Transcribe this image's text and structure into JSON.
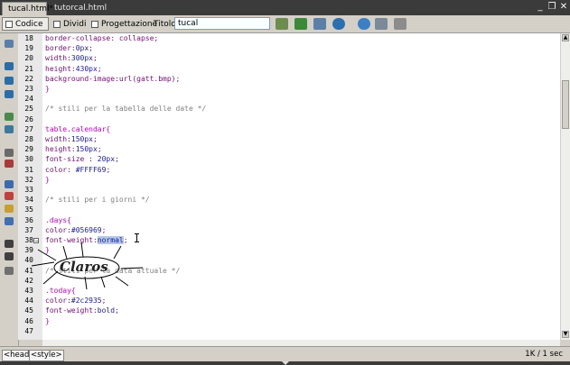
{
  "tabs": [
    {
      "label": "tucal.html*",
      "active": true
    },
    {
      "label": "tutorcal.html",
      "active": false
    }
  ],
  "window_controls": {
    "minimize": "_",
    "restore": "❐",
    "close": "✕"
  },
  "toolbar": {
    "code_label": "Codice",
    "split_label": "Dividi",
    "design_label": "Progettazione",
    "title_label": "Titolo:",
    "title_value": "tucal"
  },
  "editor": {
    "lines": [
      {
        "num": "18",
        "segments": [
          {
            "t": "border-collapse: collapse;",
            "c": "#7a0c7a"
          }
        ]
      },
      {
        "num": "19",
        "segments": [
          {
            "t": "border:",
            "c": "#7a0c7a"
          },
          {
            "t": "0px",
            "c": "#1a1aa6"
          },
          {
            "t": ";",
            "c": "#7a0c7a"
          }
        ]
      },
      {
        "num": "20",
        "segments": [
          {
            "t": "width:",
            "c": "#7a0c7a"
          },
          {
            "t": "300px",
            "c": "#1a1aa6"
          },
          {
            "t": ";",
            "c": "#7a0c7a"
          }
        ]
      },
      {
        "num": "21",
        "segments": [
          {
            "t": "height:",
            "c": "#7a0c7a"
          },
          {
            "t": "430px",
            "c": "#1a1aa6"
          },
          {
            "t": ";",
            "c": "#7a0c7a"
          }
        ]
      },
      {
        "num": "22",
        "segments": [
          {
            "t": "background-image:url(gatt.bmp);",
            "c": "#7a0c7a"
          }
        ]
      },
      {
        "num": "23",
        "segments": [
          {
            "t": "}",
            "c": "#cc00cc"
          }
        ]
      },
      {
        "num": "24",
        "segments": []
      },
      {
        "num": "25",
        "segments": [
          {
            "t": "/* stili per la tabella delle date */",
            "c": "#808080"
          }
        ]
      },
      {
        "num": "26",
        "segments": []
      },
      {
        "num": "27",
        "segments": [
          {
            "t": "table.calendar{",
            "c": "#cc00cc"
          }
        ]
      },
      {
        "num": "28",
        "segments": [
          {
            "t": "width:",
            "c": "#7a0c7a"
          },
          {
            "t": "150px",
            "c": "#1a1aa6"
          },
          {
            "t": ";",
            "c": "#7a0c7a"
          }
        ]
      },
      {
        "num": "29",
        "segments": [
          {
            "t": "height:",
            "c": "#7a0c7a"
          },
          {
            "t": "150px",
            "c": "#1a1aa6"
          },
          {
            "t": ";",
            "c": "#7a0c7a"
          }
        ]
      },
      {
        "num": "30",
        "segments": [
          {
            "t": "font-size : ",
            "c": "#7a0c7a"
          },
          {
            "t": "20px",
            "c": "#1a1aa6"
          },
          {
            "t": ";",
            "c": "#7a0c7a"
          }
        ]
      },
      {
        "num": "31",
        "segments": [
          {
            "t": "color: ",
            "c": "#7a0c7a"
          },
          {
            "t": "#FFFF69",
            "c": "#1a1aa6"
          },
          {
            "t": ";",
            "c": "#7a0c7a"
          }
        ]
      },
      {
        "num": "32",
        "segments": [
          {
            "t": "}",
            "c": "#cc00cc"
          }
        ]
      },
      {
        "num": "33",
        "segments": []
      },
      {
        "num": "34",
        "segments": [
          {
            "t": "/* stili per i giorni */",
            "c": "#808080"
          }
        ]
      },
      {
        "num": "35",
        "segments": []
      },
      {
        "num": "36",
        "segments": [
          {
            "t": ".days{",
            "c": "#cc00cc"
          }
        ]
      },
      {
        "num": "37",
        "segments": [
          {
            "t": "color:",
            "c": "#7a0c7a"
          },
          {
            "t": "#056969",
            "c": "#1a1aa6"
          },
          {
            "t": ";",
            "c": "#7a0c7a"
          }
        ]
      },
      {
        "num": "38",
        "segments": [
          {
            "t": "font-weight:",
            "c": "#7a0c7a"
          },
          {
            "t": "normal",
            "c": "#1a1aa6",
            "hl": true
          },
          {
            "t": ";",
            "c": "#7a0c7a"
          }
        ]
      },
      {
        "num": "39",
        "segments": [
          {
            "t": "}",
            "c": "#cc00cc"
          }
        ]
      },
      {
        "num": "40",
        "segments": []
      },
      {
        "num": "41",
        "segments": [
          {
            "t": "/* stili per la data attuale */",
            "c": "#808080"
          }
        ]
      },
      {
        "num": "42",
        "segments": []
      },
      {
        "num": "43",
        "segments": [
          {
            "t": ".today{",
            "c": "#cc00cc"
          }
        ]
      },
      {
        "num": "44",
        "segments": [
          {
            "t": "color:",
            "c": "#7a0c7a"
          },
          {
            "t": "#2c2935",
            "c": "#1a1aa6"
          },
          {
            "t": ";",
            "c": "#7a0c7a"
          }
        ]
      },
      {
        "num": "45",
        "segments": [
          {
            "t": "font-weight:",
            "c": "#7a0c7a"
          },
          {
            "t": "bold",
            "c": "#1a1aa6"
          },
          {
            "t": ";",
            "c": "#7a0c7a"
          }
        ]
      },
      {
        "num": "46",
        "segments": [
          {
            "t": "}",
            "c": "#cc00cc"
          }
        ]
      },
      {
        "num": "47",
        "segments": []
      }
    ]
  },
  "watermark_text": "Claros",
  "statusbar": {
    "tag_head": "<head>",
    "tag_style": "<style>",
    "size_info": "1K / 1 sec"
  }
}
